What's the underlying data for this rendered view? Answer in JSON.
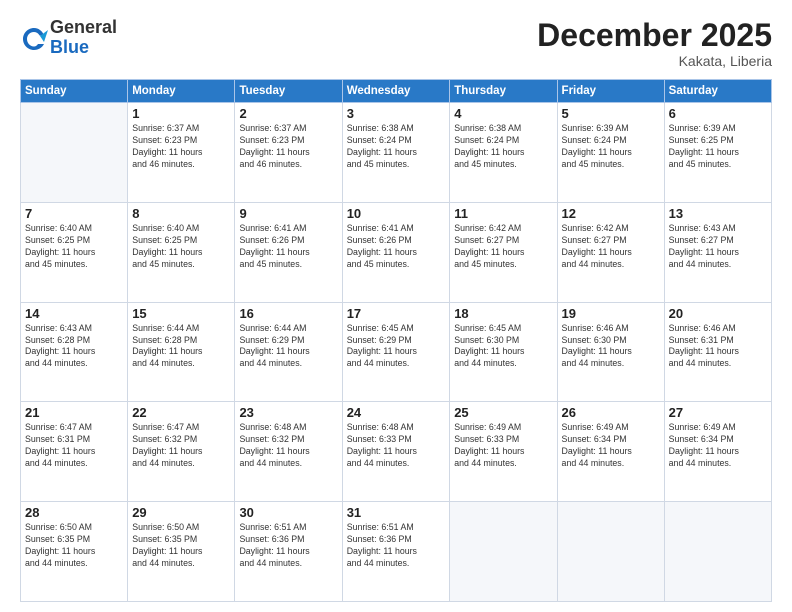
{
  "header": {
    "logo_general": "General",
    "logo_blue": "Blue",
    "month_title": "December 2025",
    "location": "Kakata, Liberia"
  },
  "days_of_week": [
    "Sunday",
    "Monday",
    "Tuesday",
    "Wednesday",
    "Thursday",
    "Friday",
    "Saturday"
  ],
  "weeks": [
    [
      {
        "day": "",
        "info": ""
      },
      {
        "day": "1",
        "info": "Sunrise: 6:37 AM\nSunset: 6:23 PM\nDaylight: 11 hours\nand 46 minutes."
      },
      {
        "day": "2",
        "info": "Sunrise: 6:37 AM\nSunset: 6:23 PM\nDaylight: 11 hours\nand 46 minutes."
      },
      {
        "day": "3",
        "info": "Sunrise: 6:38 AM\nSunset: 6:24 PM\nDaylight: 11 hours\nand 45 minutes."
      },
      {
        "day": "4",
        "info": "Sunrise: 6:38 AM\nSunset: 6:24 PM\nDaylight: 11 hours\nand 45 minutes."
      },
      {
        "day": "5",
        "info": "Sunrise: 6:39 AM\nSunset: 6:24 PM\nDaylight: 11 hours\nand 45 minutes."
      },
      {
        "day": "6",
        "info": "Sunrise: 6:39 AM\nSunset: 6:25 PM\nDaylight: 11 hours\nand 45 minutes."
      }
    ],
    [
      {
        "day": "7",
        "info": "Sunrise: 6:40 AM\nSunset: 6:25 PM\nDaylight: 11 hours\nand 45 minutes."
      },
      {
        "day": "8",
        "info": "Sunrise: 6:40 AM\nSunset: 6:25 PM\nDaylight: 11 hours\nand 45 minutes."
      },
      {
        "day": "9",
        "info": "Sunrise: 6:41 AM\nSunset: 6:26 PM\nDaylight: 11 hours\nand 45 minutes."
      },
      {
        "day": "10",
        "info": "Sunrise: 6:41 AM\nSunset: 6:26 PM\nDaylight: 11 hours\nand 45 minutes."
      },
      {
        "day": "11",
        "info": "Sunrise: 6:42 AM\nSunset: 6:27 PM\nDaylight: 11 hours\nand 45 minutes."
      },
      {
        "day": "12",
        "info": "Sunrise: 6:42 AM\nSunset: 6:27 PM\nDaylight: 11 hours\nand 44 minutes."
      },
      {
        "day": "13",
        "info": "Sunrise: 6:43 AM\nSunset: 6:27 PM\nDaylight: 11 hours\nand 44 minutes."
      }
    ],
    [
      {
        "day": "14",
        "info": "Sunrise: 6:43 AM\nSunset: 6:28 PM\nDaylight: 11 hours\nand 44 minutes."
      },
      {
        "day": "15",
        "info": "Sunrise: 6:44 AM\nSunset: 6:28 PM\nDaylight: 11 hours\nand 44 minutes."
      },
      {
        "day": "16",
        "info": "Sunrise: 6:44 AM\nSunset: 6:29 PM\nDaylight: 11 hours\nand 44 minutes."
      },
      {
        "day": "17",
        "info": "Sunrise: 6:45 AM\nSunset: 6:29 PM\nDaylight: 11 hours\nand 44 minutes."
      },
      {
        "day": "18",
        "info": "Sunrise: 6:45 AM\nSunset: 6:30 PM\nDaylight: 11 hours\nand 44 minutes."
      },
      {
        "day": "19",
        "info": "Sunrise: 6:46 AM\nSunset: 6:30 PM\nDaylight: 11 hours\nand 44 minutes."
      },
      {
        "day": "20",
        "info": "Sunrise: 6:46 AM\nSunset: 6:31 PM\nDaylight: 11 hours\nand 44 minutes."
      }
    ],
    [
      {
        "day": "21",
        "info": "Sunrise: 6:47 AM\nSunset: 6:31 PM\nDaylight: 11 hours\nand 44 minutes."
      },
      {
        "day": "22",
        "info": "Sunrise: 6:47 AM\nSunset: 6:32 PM\nDaylight: 11 hours\nand 44 minutes."
      },
      {
        "day": "23",
        "info": "Sunrise: 6:48 AM\nSunset: 6:32 PM\nDaylight: 11 hours\nand 44 minutes."
      },
      {
        "day": "24",
        "info": "Sunrise: 6:48 AM\nSunset: 6:33 PM\nDaylight: 11 hours\nand 44 minutes."
      },
      {
        "day": "25",
        "info": "Sunrise: 6:49 AM\nSunset: 6:33 PM\nDaylight: 11 hours\nand 44 minutes."
      },
      {
        "day": "26",
        "info": "Sunrise: 6:49 AM\nSunset: 6:34 PM\nDaylight: 11 hours\nand 44 minutes."
      },
      {
        "day": "27",
        "info": "Sunrise: 6:49 AM\nSunset: 6:34 PM\nDaylight: 11 hours\nand 44 minutes."
      }
    ],
    [
      {
        "day": "28",
        "info": "Sunrise: 6:50 AM\nSunset: 6:35 PM\nDaylight: 11 hours\nand 44 minutes."
      },
      {
        "day": "29",
        "info": "Sunrise: 6:50 AM\nSunset: 6:35 PM\nDaylight: 11 hours\nand 44 minutes."
      },
      {
        "day": "30",
        "info": "Sunrise: 6:51 AM\nSunset: 6:36 PM\nDaylight: 11 hours\nand 44 minutes."
      },
      {
        "day": "31",
        "info": "Sunrise: 6:51 AM\nSunset: 6:36 PM\nDaylight: 11 hours\nand 44 minutes."
      },
      {
        "day": "",
        "info": ""
      },
      {
        "day": "",
        "info": ""
      },
      {
        "day": "",
        "info": ""
      }
    ]
  ]
}
